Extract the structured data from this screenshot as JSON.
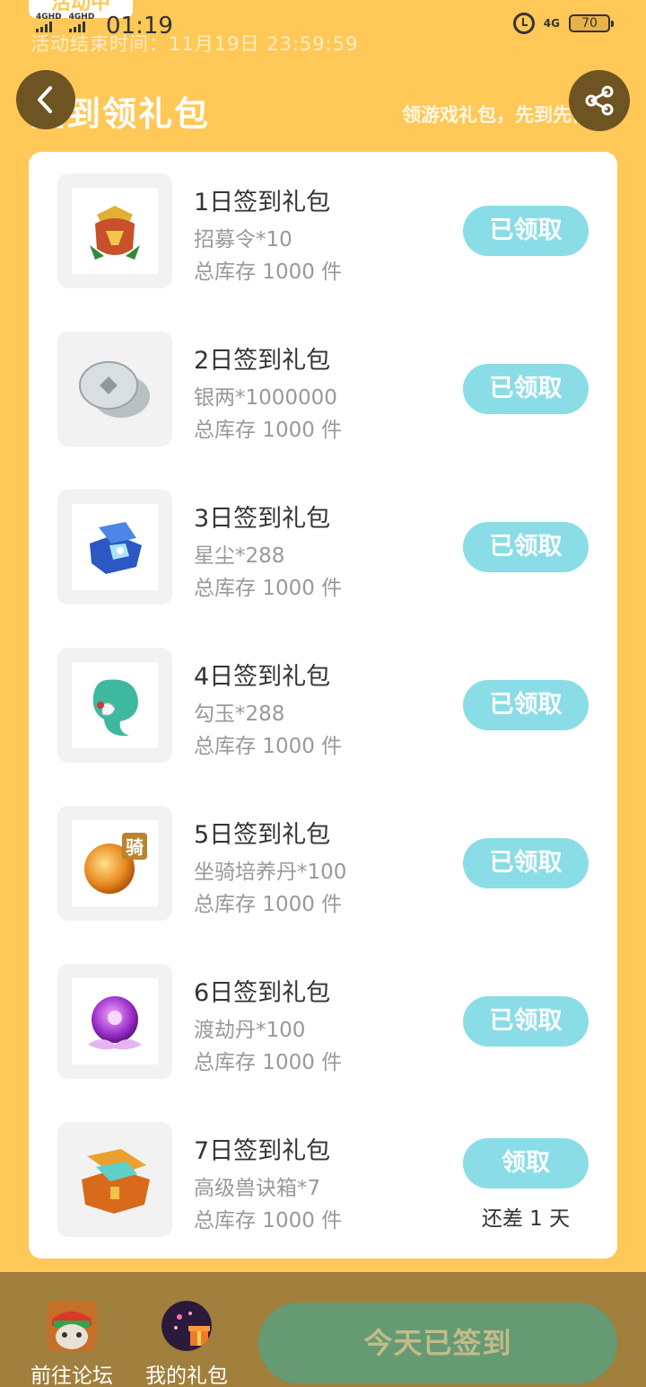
{
  "status_bar": {
    "chip_label": "活动中",
    "sim1_label": "4GHD",
    "sim2_label": "4GHD",
    "time": "01:19",
    "network_label": "4G",
    "battery": "70"
  },
  "header": {
    "end_time_text": "活动结束时间：11月19日 23:59:59",
    "title": "签到领礼包",
    "subtitle": "领游戏礼包，先到先得"
  },
  "items": [
    {
      "title": "1日签到礼包",
      "reward": "招募令*10",
      "stock": "总库存 1000 件",
      "button": "已领取",
      "icon": "badge-icon"
    },
    {
      "title": "2日签到礼包",
      "reward": "银两*1000000",
      "stock": "总库存 1000 件",
      "button": "已领取",
      "icon": "silver-coins-icon"
    },
    {
      "title": "3日签到礼包",
      "reward": "星尘*288",
      "stock": "总库存 1000 件",
      "button": "已领取",
      "icon": "stardust-box-icon"
    },
    {
      "title": "4日签到礼包",
      "reward": "勾玉*288",
      "stock": "总库存 1000 件",
      "button": "已领取",
      "icon": "jade-icon"
    },
    {
      "title": "5日签到礼包",
      "reward": "坐骑培养丹*100",
      "stock": "总库存 1000 件",
      "button": "已领取",
      "icon": "mount-pill-icon"
    },
    {
      "title": "6日签到礼包",
      "reward": "渡劫丹*100",
      "stock": "总库存 1000 件",
      "button": "已领取",
      "icon": "tribulation-pill-icon"
    },
    {
      "title": "7日签到礼包",
      "reward": "高级兽诀箱*7",
      "stock": "总库存 1000 件",
      "button": "领取",
      "remain": "还差 1 天",
      "icon": "treasure-chest-icon"
    }
  ],
  "bottom": {
    "forum_label": "前往论坛",
    "gifts_label": "我的礼包",
    "checkin_label": "今天已签到"
  },
  "colors": {
    "background": "#ffc857",
    "claim_button": "#8adde6",
    "checkin_button": "#659a73",
    "bottom_bar": "#a17f3c"
  }
}
